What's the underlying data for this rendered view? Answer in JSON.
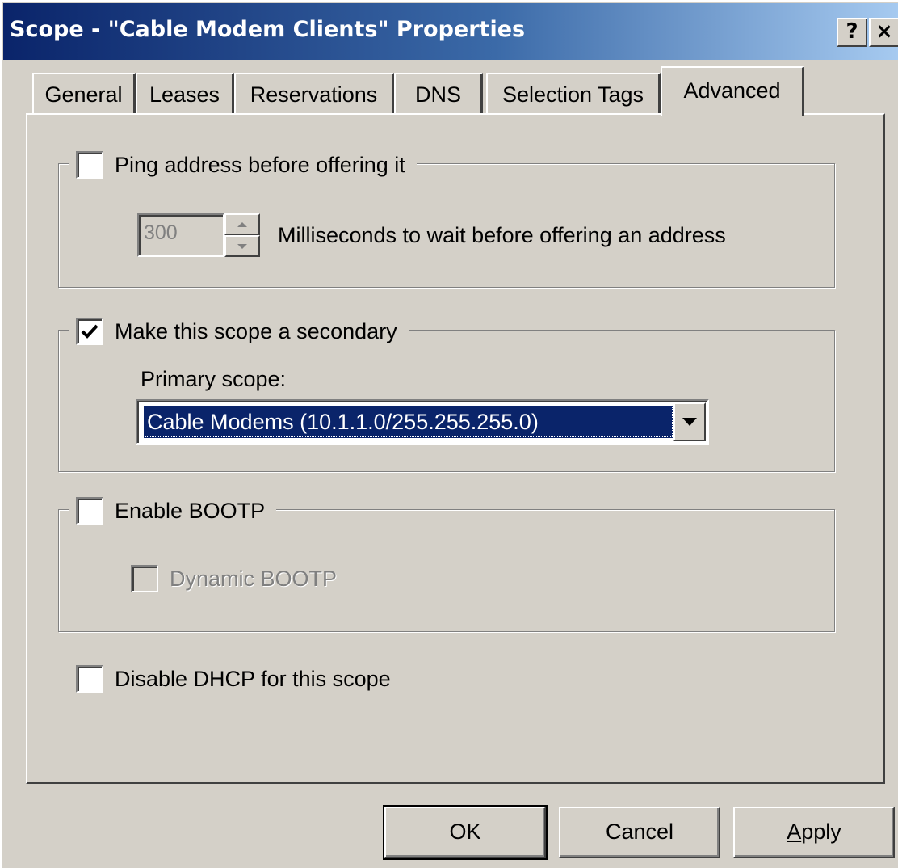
{
  "window": {
    "title": "Scope - \"Cable Modem Clients\" Properties",
    "help_button": "?",
    "close_button": "×"
  },
  "tabs": [
    {
      "label": "General",
      "active": false
    },
    {
      "label": "Leases",
      "active": false
    },
    {
      "label": "Reservations",
      "active": false
    },
    {
      "label": "DNS",
      "active": false
    },
    {
      "label": "Selection Tags",
      "active": false
    },
    {
      "label": "Advanced",
      "active": true
    }
  ],
  "ping": {
    "label": "Ping address before offering it",
    "checked": false,
    "wait_value": "300",
    "wait_label": "Milliseconds to wait before offering an address"
  },
  "secondary": {
    "label": "Make this scope a secondary",
    "checked": true,
    "primary_scope_label": "Primary scope:",
    "primary_scope_value": "Cable Modems (10.1.1.0/255.255.255.0)"
  },
  "bootp": {
    "label": "Enable BOOTP",
    "checked": false,
    "dynamic_label": "Dynamic BOOTP",
    "dynamic_checked": false
  },
  "disable_dhcp": {
    "label": "Disable DHCP for this scope",
    "checked": false
  },
  "buttons": {
    "ok": "OK",
    "cancel": "Cancel",
    "apply_accel": "A",
    "apply_rest": "pply"
  },
  "colors": {
    "title_active": "#0a246a",
    "face": "#d4d0c8",
    "selection": "#0a246a"
  }
}
